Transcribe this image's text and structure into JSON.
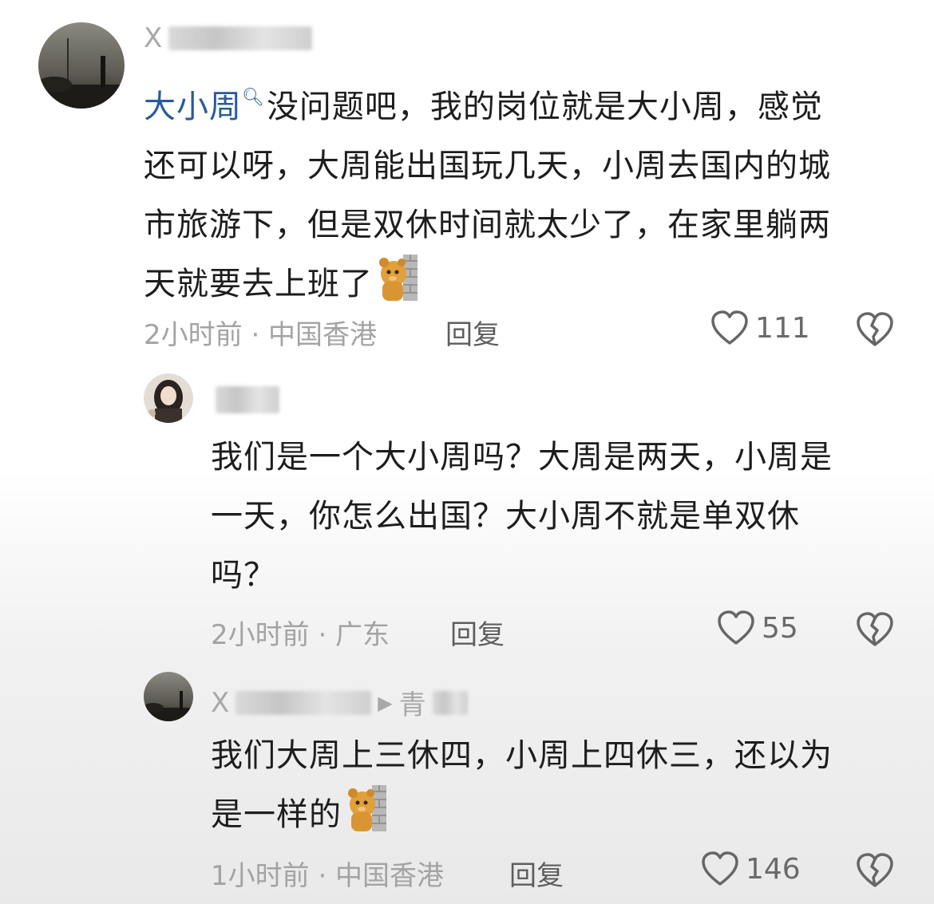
{
  "comments": [
    {
      "username": "X",
      "link_text": "大小周",
      "lines": [
        "没问题吧，我的岗位就是大小周，感觉",
        "还可以呀，大周能出国玩几天，小周去国内的城",
        "市旅游下，但是双休时间就太少了，在家里躺两",
        "天就要去上班了"
      ],
      "meta": "2小时前 · 中国香港",
      "reply_label": "回复",
      "likes": "111",
      "emoji": "bear-peeking-wall-emoji"
    },
    {
      "username": "",
      "lines": [
        "我们是一个大小周吗？大周是两天，小周是",
        "一天，你怎么出国？大小周不就是单双休",
        "吗？"
      ],
      "meta": "2小时前 · 广东",
      "reply_label": "回复",
      "likes": "55"
    },
    {
      "username": "X",
      "reply_to": "青",
      "lines": [
        "我们大周上三休四，小周上四休三，还以为",
        "是一样的"
      ],
      "meta": "1小时前 · 中国香港",
      "reply_label": "回复",
      "likes": "146",
      "emoji": "bear-peeking-wall-emoji"
    }
  ],
  "colors": {
    "link": "#2a5a9b",
    "meta": "#a3a3a3",
    "text": "#1d1d1d"
  }
}
